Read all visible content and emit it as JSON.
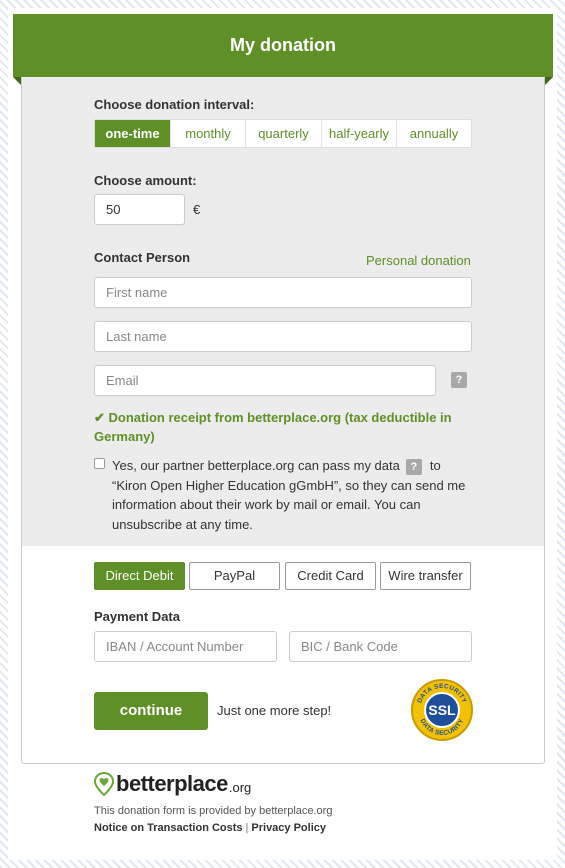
{
  "header": {
    "title": "My donation"
  },
  "interval": {
    "label": "Choose donation interval:",
    "options": [
      "one-time",
      "monthly",
      "quarterly",
      "half-yearly",
      "annually"
    ],
    "selected": "one-time"
  },
  "amount": {
    "label": "Choose amount:",
    "value": "50",
    "currency": "€"
  },
  "contact": {
    "label": "Contact Person",
    "personal_link": "Personal donation",
    "first_name_placeholder": "First name",
    "last_name_placeholder": "Last name",
    "email_placeholder": "Email",
    "help_mark": "?"
  },
  "receipt": "✔ Donation receipt from betterplace.org (tax deductible in Germany)",
  "consent": {
    "text_before": "Yes, our partner betterplace.org can pass my data",
    "help_mark": "?",
    "text_after": "to “Kiron Open Higher Education gGmbH”, so they can send me information about their work by mail or email. You can unsubscribe at any time.",
    "checked": false
  },
  "payment": {
    "methods": [
      "Direct Debit",
      "PayPal",
      "Credit Card",
      "Wire transfer"
    ],
    "selected": "Direct Debit",
    "data_label": "Payment Data",
    "iban_placeholder": "IBAN / Account Number",
    "bic_placeholder": "BIC / Bank Code"
  },
  "actions": {
    "continue_label": "continue",
    "step_note": "Just one more step!"
  },
  "badge": {
    "top_text": "DATA SECURITY",
    "center_text": "SSL",
    "bottom_text": "DATA SECURITY"
  },
  "footer": {
    "brand": "betterplace",
    "tld": ".org",
    "provided_by": "This donation form is provided by betterplace.org",
    "notice_link": "Notice on Transaction Costs",
    "separator": "|",
    "privacy_link": "Privacy Policy"
  },
  "colors": {
    "brand_green": "#5f8f27",
    "panel_grey": "#ececec",
    "badge_gold": "#f2c200",
    "badge_blue": "#1f4f9a"
  }
}
